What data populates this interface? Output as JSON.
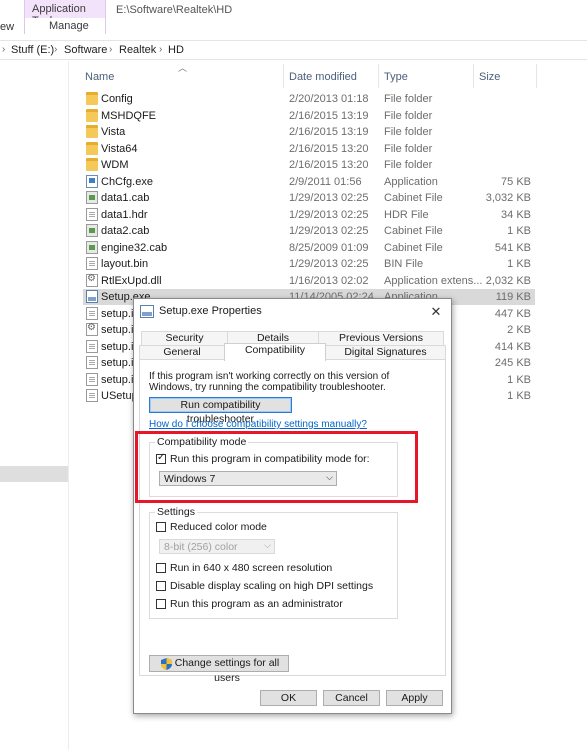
{
  "ribbon": {
    "context_tab": "Application Tools",
    "manage_tab": "Manage",
    "view_tab": "ew",
    "title_path": "E:\\Software\\Realtek\\HD"
  },
  "address": {
    "crumbs": [
      "Stuff (E:)",
      "Software",
      "Realtek",
      "HD"
    ]
  },
  "columns": {
    "name": "Name",
    "date": "Date modified",
    "type": "Type",
    "size": "Size"
  },
  "files": [
    {
      "name": "Config",
      "date": "2/20/2013 01:18",
      "type": "File folder",
      "size": "",
      "icon": "folder-icon"
    },
    {
      "name": "MSHDQFE",
      "date": "2/16/2015 13:19",
      "type": "File folder",
      "size": "",
      "icon": "folder-icon"
    },
    {
      "name": "Vista",
      "date": "2/16/2015 13:19",
      "type": "File folder",
      "size": "",
      "icon": "folder-icon"
    },
    {
      "name": "Vista64",
      "date": "2/16/2015 13:20",
      "type": "File folder",
      "size": "",
      "icon": "folder-icon"
    },
    {
      "name": "WDM",
      "date": "2/16/2015 13:20",
      "type": "File folder",
      "size": "",
      "icon": "folder-icon"
    },
    {
      "name": "ChCfg.exe",
      "date": "2/9/2011 01:56",
      "type": "Application",
      "size": "75 KB",
      "icon": "app-icon"
    },
    {
      "name": "data1.cab",
      "date": "1/29/2013 02:25",
      "type": "Cabinet File",
      "size": "3,032 KB",
      "icon": "cab-icon"
    },
    {
      "name": "data1.hdr",
      "date": "1/29/2013 02:25",
      "type": "HDR File",
      "size": "34 KB",
      "icon": "doc-icon"
    },
    {
      "name": "data2.cab",
      "date": "1/29/2013 02:25",
      "type": "Cabinet File",
      "size": "1 KB",
      "icon": "cab-icon"
    },
    {
      "name": "engine32.cab",
      "date": "8/25/2009 01:09",
      "type": "Cabinet File",
      "size": "541 KB",
      "icon": "cab-icon"
    },
    {
      "name": "layout.bin",
      "date": "1/29/2013 02:25",
      "type": "BIN File",
      "size": "1 KB",
      "icon": "doc-icon"
    },
    {
      "name": "RtlExUpd.dll",
      "date": "1/16/2013 02:02",
      "type": "Application extens...",
      "size": "2,032 KB",
      "icon": "dll-icon"
    },
    {
      "name": "Setup.exe",
      "date": "11/14/2005 02:24",
      "type": "Application",
      "size": "119 KB",
      "icon": "setup-icon",
      "selected": true
    },
    {
      "name": "setup.ib",
      "date": "",
      "type": "",
      "size": "447 KB",
      "icon": "doc-icon"
    },
    {
      "name": "setup.in",
      "date": "",
      "type": "",
      "size": "2 KB",
      "icon": "dll-icon"
    },
    {
      "name": "setup.in",
      "date": "",
      "type": "",
      "size": "414 KB",
      "icon": "doc-icon"
    },
    {
      "name": "setup.is",
      "date": "",
      "type": "",
      "size": "245 KB",
      "icon": "doc-icon"
    },
    {
      "name": "setup.is",
      "date": "",
      "type": "",
      "size": "1 KB",
      "icon": "doc-icon"
    },
    {
      "name": "USetup.",
      "date": "",
      "type": "",
      "size": "1 KB",
      "icon": "doc-icon"
    }
  ],
  "dialog": {
    "title": "Setup.exe Properties",
    "close": "✕",
    "tabs_row1": [
      "Security",
      "Details",
      "Previous Versions"
    ],
    "tabs_row2": [
      "General",
      "Compatibility",
      "Digital Signatures"
    ],
    "active_tab": "Compatibility",
    "intro_text": "If this program isn't working correctly on this version of Windows, try running the compatibility troubleshooter.",
    "troubleshooter_button": "Run compatibility troubleshooter",
    "manual_link": "How do I choose compatibility settings manually?",
    "compat_mode": {
      "group_label": "Compatibility mode",
      "checkbox_label": "Run this program in compatibility mode for:",
      "checked": true,
      "selected_os": "Windows 7"
    },
    "settings": {
      "group_label": "Settings",
      "reduced_color": "Reduced color mode",
      "color_select": "8-bit (256) color",
      "res_640": "Run in 640 x 480 screen resolution",
      "dpi": "Disable display scaling on high DPI settings",
      "admin": "Run this program as an administrator"
    },
    "change_all_button": "Change settings for all users",
    "ok": "OK",
    "cancel": "Cancel",
    "apply": "Apply"
  },
  "colors": {
    "highlight_box": "#e6172a",
    "context_tab_bg": "#f3e3fa",
    "link": "#0066cc"
  }
}
